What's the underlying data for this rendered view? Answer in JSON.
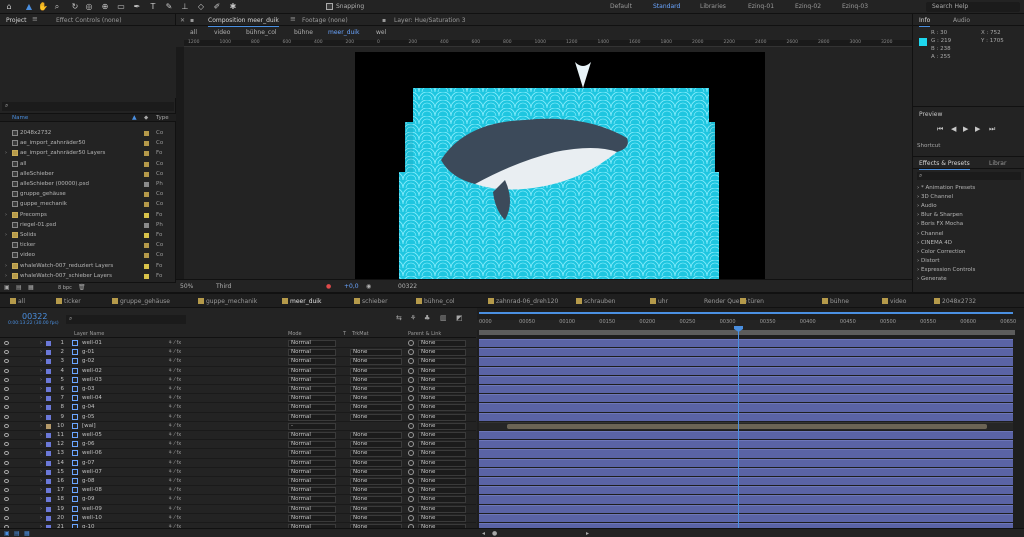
{
  "toolbar": {
    "snapping_label": "Snapping",
    "workspaces": [
      "Default",
      "Standard",
      "Libraries",
      "Ezinq-01",
      "Ezinq-02",
      "Ezinq-03"
    ],
    "active_workspace": "Standard",
    "search_placeholder": "Search Help"
  },
  "project": {
    "tabs": [
      "Project",
      "Effect Controls (none)"
    ],
    "columns": {
      "name": "Name",
      "type": "Type"
    },
    "items": [
      {
        "name": "2048x2732",
        "type": "Co",
        "folder": false,
        "label": "#b59a4a"
      },
      {
        "name": "ae_import_zahnräder50",
        "type": "Co",
        "folder": false,
        "label": "#b59a4a"
      },
      {
        "name": "ae_import_zahnräder50 Layers",
        "type": "Fo",
        "folder": true,
        "label": "#b59a4a"
      },
      {
        "name": "all",
        "type": "Co",
        "folder": false,
        "label": "#b59a4a"
      },
      {
        "name": "alleSchieber",
        "type": "Co",
        "folder": false,
        "label": "#b59a4a"
      },
      {
        "name": "alleSchieber (00000).psd",
        "type": "Ph",
        "folder": false,
        "label": "#8a8a8a"
      },
      {
        "name": "gruppe_gehäuse",
        "type": "Co",
        "folder": false,
        "label": "#b59a4a"
      },
      {
        "name": "guppe_mechanik",
        "type": "Co",
        "folder": false,
        "label": "#b59a4a"
      },
      {
        "name": "Precomps",
        "type": "Fo",
        "folder": true,
        "label": "#d8c24a"
      },
      {
        "name": "riegel-01.psd",
        "type": "Ph",
        "folder": false,
        "label": "#8a8a8a"
      },
      {
        "name": "Solids",
        "type": "Fo",
        "folder": true,
        "label": "#d8c24a"
      },
      {
        "name": "ticker",
        "type": "Co",
        "folder": false,
        "label": "#b59a4a"
      },
      {
        "name": "video",
        "type": "Co",
        "folder": false,
        "label": "#b59a4a"
      },
      {
        "name": "whaleWatch-007_reduziert Layers",
        "type": "Fo",
        "folder": true,
        "label": "#d8c24a"
      },
      {
        "name": "whaleWatch-007_schieber Layers",
        "type": "Fo",
        "folder": true,
        "label": "#d8c24a"
      },
      {
        "name": "zehnr_21.png",
        "type": "PN",
        "folder": false,
        "label": "#8a8a8a"
      },
      {
        "name": "zahnrad_20",
        "type": "",
        "folder": false,
        "label": "#8a8a8a"
      }
    ],
    "bpc": "8 bpc"
  },
  "comp": {
    "tabs": [
      "Composition meer_duik",
      "Footage (none)",
      "Layer: Hue/Saturation 3"
    ],
    "breadcrumbs": [
      "all",
      "video",
      "bühne_col",
      "bühne",
      "meer_duik",
      "wel"
    ],
    "active_crumb": "meer_duik",
    "ruler_ticks": [
      "1200",
      "1000",
      "800",
      "600",
      "400",
      "200",
      "0",
      "200",
      "400",
      "600",
      "800",
      "1000",
      "1200",
      "1400",
      "1600",
      "1800",
      "2000",
      "2200",
      "2400",
      "2600",
      "2800",
      "3000",
      "3200"
    ],
    "zoom": "50%",
    "view": "Third",
    "exposure": "+0,0",
    "timecode": "00322"
  },
  "info": {
    "tabs": [
      "Info",
      "Audio"
    ],
    "swatch": "#1ED7EE",
    "r": "R : 30",
    "g": "G : 219",
    "b": "B : 238",
    "a": "A : 255",
    "x": "X : 752",
    "y": "Y : 1705"
  },
  "preview": {
    "title": "Preview",
    "shortcut": "Shortcut"
  },
  "effects": {
    "tabs": [
      "Effects & Presets",
      "Librar"
    ],
    "items": [
      "* Animation Presets",
      "3D Channel",
      "Audio",
      "Blur & Sharpen",
      "Boris FX Mocha",
      "Channel",
      "CINEMA 4D",
      "Color Correction",
      "Distort",
      "Expression Controls",
      "Generate"
    ]
  },
  "timeline": {
    "tabs": [
      "all",
      "ticker",
      "gruppe_gehäuse",
      "guppe_mechanik",
      "meer_duik",
      "schieber",
      "bühne_col",
      "zahnrad-06_dreh120",
      "schrauben",
      "uhr",
      "Render Queue",
      "türen",
      "bühne",
      "video",
      "2048x2732"
    ],
    "active_tab": "meer_duik",
    "timecode": "00322",
    "frames": "0:00:13:22 (30.00 fps)",
    "headers": {
      "layer_name": "Layer Name",
      "mode": "Mode",
      "t": "T",
      "trkmat": "TrkMat",
      "parent": "Parent & Link"
    },
    "ruler": [
      "0000",
      "00050",
      "00100",
      "00150",
      "00200",
      "00250",
      "00300",
      "00350",
      "00400",
      "00450",
      "00500",
      "00550",
      "00600",
      "00650"
    ],
    "layers": [
      {
        "num": "1",
        "name": "well-01",
        "mode": "Normal",
        "trk": "",
        "parent": "None",
        "color": "#6b78d8"
      },
      {
        "num": "2",
        "name": "g-01",
        "mode": "Normal",
        "trk": "None",
        "parent": "None",
        "color": "#6b78d8"
      },
      {
        "num": "3",
        "name": "g-02",
        "mode": "Normal",
        "trk": "None",
        "parent": "None",
        "color": "#6b78d8"
      },
      {
        "num": "4",
        "name": "well-02",
        "mode": "Normal",
        "trk": "None",
        "parent": "None",
        "color": "#6b78d8"
      },
      {
        "num": "5",
        "name": "well-03",
        "mode": "Normal",
        "trk": "None",
        "parent": "None",
        "color": "#6b78d8"
      },
      {
        "num": "6",
        "name": "g-03",
        "mode": "Normal",
        "trk": "None",
        "parent": "None",
        "color": "#6b78d8"
      },
      {
        "num": "7",
        "name": "well-04",
        "mode": "Normal",
        "trk": "None",
        "parent": "None",
        "color": "#6b78d8"
      },
      {
        "num": "8",
        "name": "g-04",
        "mode": "Normal",
        "trk": "None",
        "parent": "None",
        "color": "#6b78d8"
      },
      {
        "num": "9",
        "name": "g-05",
        "mode": "Normal",
        "trk": "None",
        "parent": "None",
        "color": "#6b78d8"
      },
      {
        "num": "10",
        "name": "[wal]",
        "mode": "-",
        "trk": "",
        "parent": "None",
        "color": "#b59a6a",
        "null": true
      },
      {
        "num": "11",
        "name": "well-05",
        "mode": "Normal",
        "trk": "None",
        "parent": "None",
        "color": "#6b78d8"
      },
      {
        "num": "12",
        "name": "g-06",
        "mode": "Normal",
        "trk": "None",
        "parent": "None",
        "color": "#6b78d8"
      },
      {
        "num": "13",
        "name": "well-06",
        "mode": "Normal",
        "trk": "None",
        "parent": "None",
        "color": "#6b78d8"
      },
      {
        "num": "14",
        "name": "g-07",
        "mode": "Normal",
        "trk": "None",
        "parent": "None",
        "color": "#6b78d8"
      },
      {
        "num": "15",
        "name": "well-07",
        "mode": "Normal",
        "trk": "None",
        "parent": "None",
        "color": "#6b78d8"
      },
      {
        "num": "16",
        "name": "g-08",
        "mode": "Normal",
        "trk": "None",
        "parent": "None",
        "color": "#6b78d8"
      },
      {
        "num": "17",
        "name": "well-08",
        "mode": "Normal",
        "trk": "None",
        "parent": "None",
        "color": "#6b78d8"
      },
      {
        "num": "18",
        "name": "g-09",
        "mode": "Normal",
        "trk": "None",
        "parent": "None",
        "color": "#6b78d8"
      },
      {
        "num": "19",
        "name": "well-09",
        "mode": "Normal",
        "trk": "None",
        "parent": "None",
        "color": "#6b78d8"
      },
      {
        "num": "20",
        "name": "well-10",
        "mode": "Normal",
        "trk": "None",
        "parent": "None",
        "color": "#6b78d8"
      },
      {
        "num": "21",
        "name": "g-10",
        "mode": "Normal",
        "trk": "None",
        "parent": "None",
        "color": "#6b78d8"
      }
    ]
  }
}
